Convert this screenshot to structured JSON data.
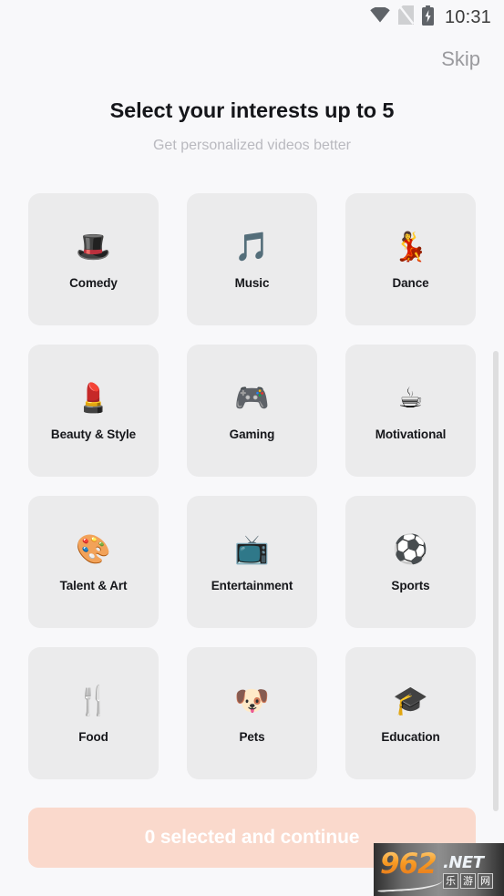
{
  "status_bar": {
    "time": "10:31",
    "icons": [
      "wifi-icon",
      "no-sim-icon",
      "battery-charging-icon"
    ]
  },
  "header": {
    "skip_label": "Skip",
    "title": "Select your interests up to 5",
    "subtitle": "Get personalized videos better"
  },
  "interests": [
    {
      "label": "Comedy",
      "emoji": "🎩",
      "icon": "top-hat-icon",
      "selected": false
    },
    {
      "label": "Music",
      "emoji": "🎵",
      "icon": "musical-note-icon",
      "selected": false
    },
    {
      "label": "Dance",
      "emoji": "💃",
      "icon": "dancer-icon",
      "selected": false
    },
    {
      "label": "Beauty & Style",
      "emoji": "💄",
      "icon": "lipstick-icon",
      "selected": false
    },
    {
      "label": "Gaming",
      "emoji": "🎮",
      "icon": "game-controller-icon",
      "selected": false
    },
    {
      "label": "Motivational",
      "emoji": "☕",
      "icon": "hot-beverage-icon",
      "selected": false
    },
    {
      "label": "Talent & Art",
      "emoji": "🎨",
      "icon": "artist-palette-icon",
      "selected": false
    },
    {
      "label": "Entertainment",
      "emoji": "📺",
      "icon": "television-icon",
      "selected": false
    },
    {
      "label": "Sports",
      "emoji": "⚽",
      "icon": "soccer-ball-icon",
      "selected": false
    },
    {
      "label": "Food",
      "emoji": "🍴",
      "icon": "fork-and-knife-icon",
      "selected": false
    },
    {
      "label": "Pets",
      "emoji": "🐶",
      "icon": "dog-face-icon",
      "selected": false
    },
    {
      "label": "Education",
      "emoji": "🎓",
      "icon": "graduation-cap-icon",
      "selected": false
    }
  ],
  "footer": {
    "selected_count": 0,
    "continue_label": "0 selected and continue"
  },
  "watermark": {
    "brand": "962",
    "tld": ".NET",
    "chinese": "乐游网"
  },
  "colors": {
    "page_background": "#f8f8fa",
    "card_background": "#ebebec",
    "title_text": "#15161a",
    "subtitle_text": "#b9b9bf",
    "skip_text": "#9a9a9e",
    "cta_background": "#fad9cc",
    "cta_text": "#ffffff",
    "scrollbar_thumb": "#dededf"
  }
}
